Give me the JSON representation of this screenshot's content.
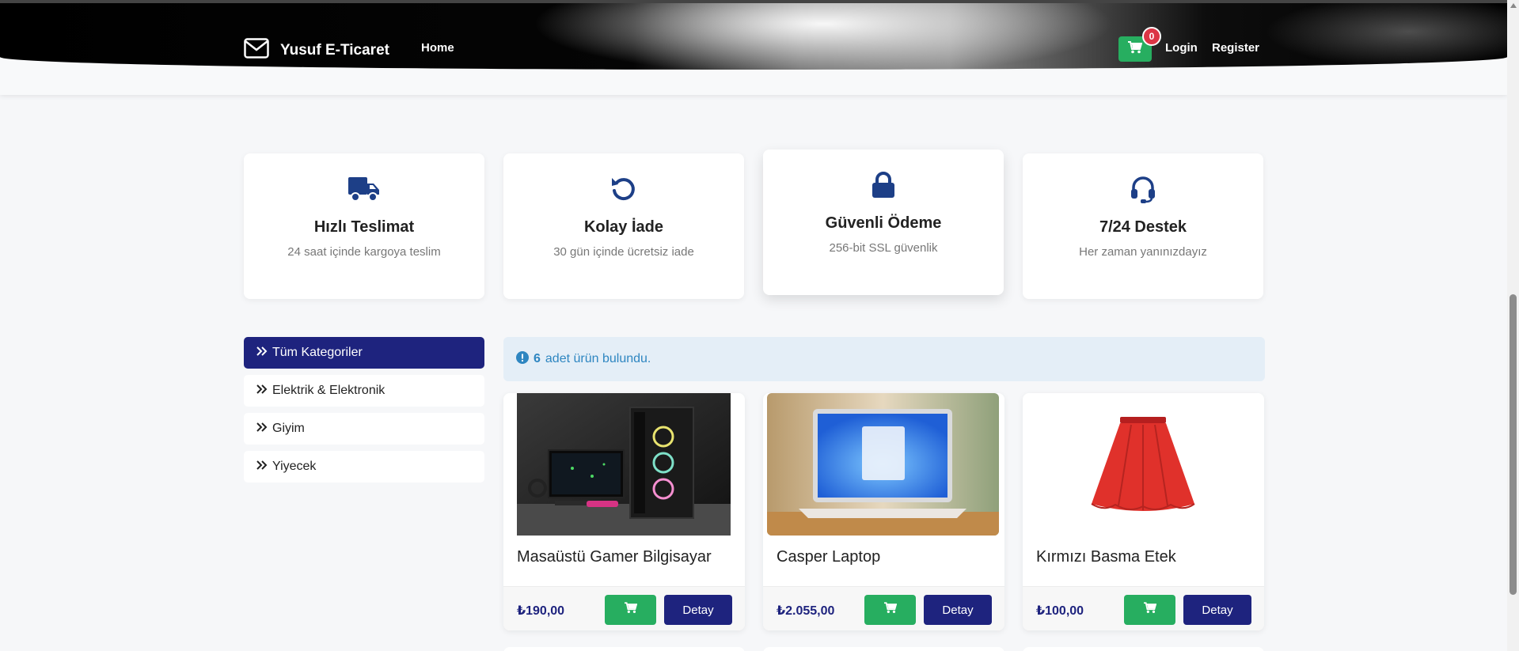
{
  "header": {
    "brand": "Yusuf E-Ticaret",
    "home": "Home",
    "cart_count": "0",
    "login": "Login",
    "register": "Register"
  },
  "features": [
    {
      "icon": "truck-icon",
      "title": "Hızlı Teslimat",
      "subtitle": "24 saat içinde kargoya teslim"
    },
    {
      "icon": "undo-icon",
      "title": "Kolay İade",
      "subtitle": "30 gün içinde ücretsiz iade"
    },
    {
      "icon": "lock-icon",
      "title": "Güvenli Ödeme",
      "subtitle": "256-bit SSL güvenlik"
    },
    {
      "icon": "headset-icon",
      "title": "7/24 Destek",
      "subtitle": "Her zaman yanınızdayız"
    }
  ],
  "sidebar": {
    "categories": [
      {
        "label": "Tüm Kategoriler",
        "active": true
      },
      {
        "label": "Elektrik & Elektronik",
        "active": false
      },
      {
        "label": "Giyim",
        "active": false
      },
      {
        "label": "Yiyecek",
        "active": false
      }
    ]
  },
  "alert": {
    "count": "6",
    "text": "adet ürün bulundu."
  },
  "products": [
    {
      "title": "Masaüstü Gamer Bilgisayar",
      "price": "₺190,00",
      "detail": "Detay"
    },
    {
      "title": "Casper Laptop",
      "price": "₺2.055,00",
      "detail": "Detay"
    },
    {
      "title": "Kırmızı Basma Etek",
      "price": "₺100,00",
      "detail": "Detay"
    }
  ],
  "colors": {
    "primary": "#1e237e",
    "success": "#27ae60",
    "danger": "#dc3545",
    "info": "#2e86c1"
  }
}
